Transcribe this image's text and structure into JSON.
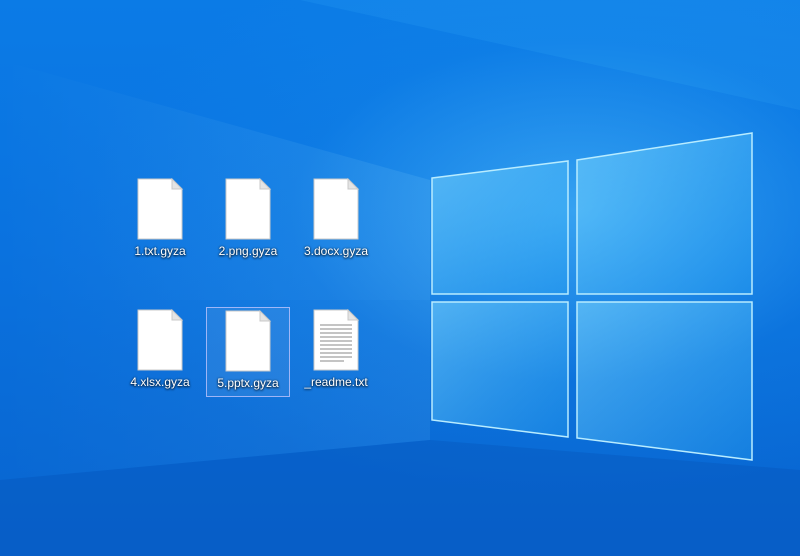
{
  "desktop": {
    "icons": [
      {
        "label": "1.txt.gyza",
        "icon": "blank-document-icon",
        "selected": false
      },
      {
        "label": "2.png.gyza",
        "icon": "blank-document-icon",
        "selected": false
      },
      {
        "label": "3.docx.gyza",
        "icon": "blank-document-icon",
        "selected": false
      },
      {
        "label": "4.xlsx.gyza",
        "icon": "blank-document-icon",
        "selected": false
      },
      {
        "label": "5.pptx.gyza",
        "icon": "blank-document-icon",
        "selected": true
      },
      {
        "label": "_readme.txt",
        "icon": "text-document-icon",
        "selected": false
      }
    ]
  },
  "colors": {
    "accent": "#0a72df",
    "label_text": "#ffffff"
  }
}
